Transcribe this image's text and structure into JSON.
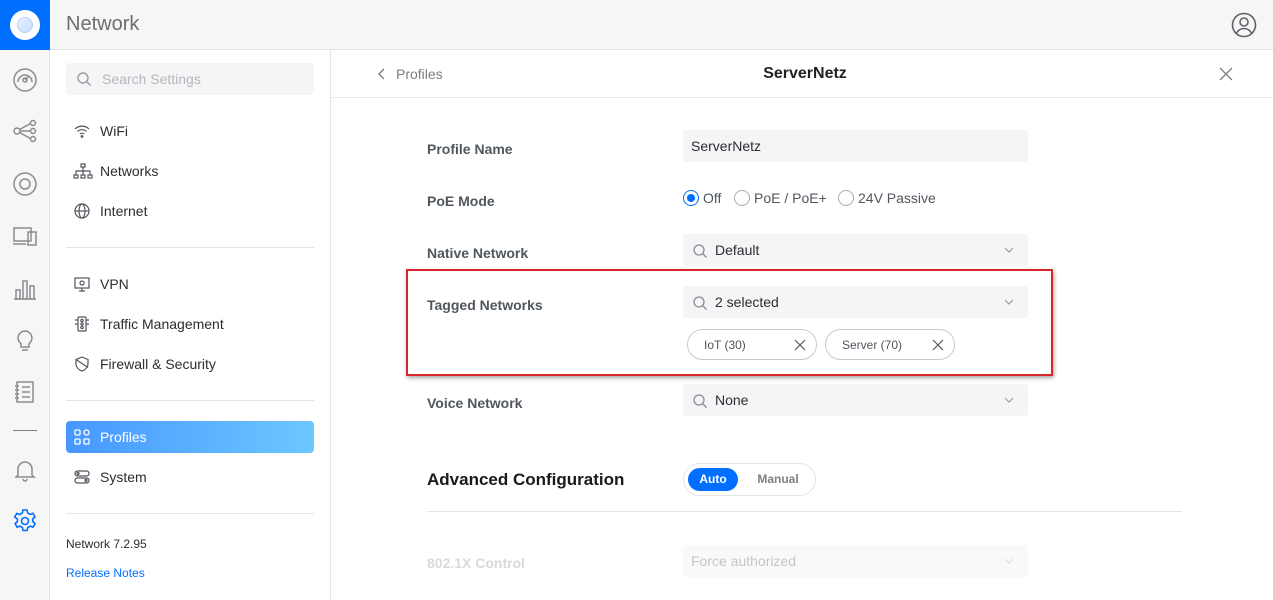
{
  "app": {
    "title": "Network"
  },
  "rail": {
    "items": [
      {
        "icon": "dashboard-icon"
      },
      {
        "icon": "topology-icon"
      },
      {
        "icon": "devices-icon"
      },
      {
        "icon": "clients-icon"
      },
      {
        "icon": "statistics-icon"
      },
      {
        "icon": "insights-icon"
      },
      {
        "icon": "system-log-icon"
      },
      {
        "icon": "alarm-icon"
      },
      {
        "icon": "settings-icon",
        "active": true
      }
    ],
    "active_color": "#006fff"
  },
  "sidebar": {
    "search_placeholder": "Search Settings",
    "items": [
      {
        "label": "WiFi",
        "icon": "wifi-icon"
      },
      {
        "label": "Networks",
        "icon": "networks-icon"
      },
      {
        "label": "Internet",
        "icon": "globe-icon"
      },
      {
        "label": "VPN",
        "icon": "vpn-icon"
      },
      {
        "label": "Traffic Management",
        "icon": "traffic-icon"
      },
      {
        "label": "Firewall & Security",
        "icon": "shield-icon"
      },
      {
        "label": "Profiles",
        "icon": "profiles-icon",
        "active": true
      },
      {
        "label": "System",
        "icon": "system-icon"
      }
    ],
    "version": "Network 7.2.95",
    "release_notes": "Release Notes"
  },
  "panel": {
    "back_label": "Profiles",
    "title": "ServerNetz",
    "profile_name": {
      "label": "Profile Name",
      "value": "ServerNetz"
    },
    "poe_mode": {
      "label": "PoE Mode",
      "options": [
        "Off",
        "PoE / PoE+",
        "24V Passive"
      ],
      "selected": "Off"
    },
    "native_network": {
      "label": "Native Network",
      "value": "Default"
    },
    "tagged_networks": {
      "label": "Tagged Networks",
      "value": "2 selected",
      "chips": [
        "IoT (30)",
        "Server (70)"
      ]
    },
    "voice_network": {
      "label": "Voice Network",
      "value": "None"
    },
    "advanced": {
      "title": "Advanced Configuration",
      "modes": [
        "Auto",
        "Manual"
      ],
      "selected": "Auto"
    },
    "dot1x": {
      "label": "802.1X Control",
      "value": "Force authorized"
    }
  },
  "colors": {
    "accent": "#006fff",
    "highlight_border": "#d9262c"
  }
}
